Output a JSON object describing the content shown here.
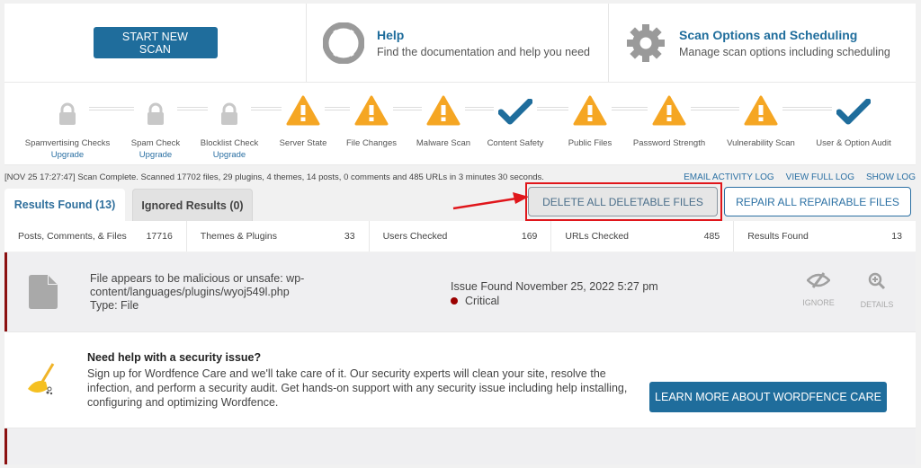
{
  "top": {
    "start_scan_label": "START NEW SCAN",
    "help": {
      "icon": "lifebuoy-icon",
      "title": "Help",
      "desc": "Find the documentation and help you need"
    },
    "options": {
      "icon": "gear-icon",
      "title": "Scan Options and Scheduling",
      "desc": "Manage scan options including scheduling"
    }
  },
  "stages": [
    {
      "label": "Spamvertising Checks",
      "status": "locked",
      "upgrade": "Upgrade"
    },
    {
      "label": "Spam Check",
      "status": "locked",
      "upgrade": "Upgrade"
    },
    {
      "label": "Blocklist Check",
      "status": "locked",
      "upgrade": "Upgrade"
    },
    {
      "label": "Server State",
      "status": "warning"
    },
    {
      "label": "File Changes",
      "status": "warning"
    },
    {
      "label": "Malware Scan",
      "status": "warning"
    },
    {
      "label": "Content Safety",
      "status": "ok"
    },
    {
      "label": "Public Files",
      "status": "warning"
    },
    {
      "label": "Password Strength",
      "status": "warning"
    },
    {
      "label": "Vulnerability Scan",
      "status": "warning"
    },
    {
      "label": "User & Option Audit",
      "status": "ok"
    }
  ],
  "colors": {
    "brand": "#1f6d9c",
    "warning": "#f5a623",
    "locked": "#c8c8c8",
    "critical": "#9b0000",
    "highlight": "#e0161b"
  },
  "status_line": "[NOV 25 17:27:47] Scan Complete. Scanned 17702 files, 29 plugins, 4 themes, 14 posts, 0 comments and 485 URLs in 3 minutes 30 seconds.",
  "log_links": [
    "EMAIL ACTIVITY LOG",
    "VIEW FULL LOG",
    "SHOW LOG"
  ],
  "tabs": [
    {
      "label": "Results Found (13)",
      "active": true
    },
    {
      "label": "Ignored Results (0)",
      "active": false
    }
  ],
  "actions": {
    "delete_all": "DELETE ALL DELETABLE FILES",
    "repair_all": "REPAIR ALL REPAIRABLE FILES"
  },
  "stats": [
    {
      "label": "Posts, Comments, & Files",
      "value": "17716"
    },
    {
      "label": "Themes & Plugins",
      "value": "33"
    },
    {
      "label": "Users Checked",
      "value": "169"
    },
    {
      "label": "URLs Checked",
      "value": "485"
    },
    {
      "label": "Results Found",
      "value": "13"
    }
  ],
  "issue": {
    "title": "File appears to be malicious or unsafe: wp-content/languages/plugins/wyoj549l.php",
    "type": "Type: File",
    "found": "Issue Found November 25, 2022 5:27 pm",
    "severity": "Critical",
    "ignore_label": "IGNORE",
    "details_label": "DETAILS"
  },
  "care": {
    "title": "Need help with a security issue?",
    "body": "Sign up for Wordfence Care and we'll take care of it. Our security experts will clean your site, resolve the infection, and perform a security audit. Get hands-on support with any security issue including help installing, configuring and optimizing Wordfence.",
    "button": "LEARN MORE ABOUT WORDFENCE CARE"
  }
}
